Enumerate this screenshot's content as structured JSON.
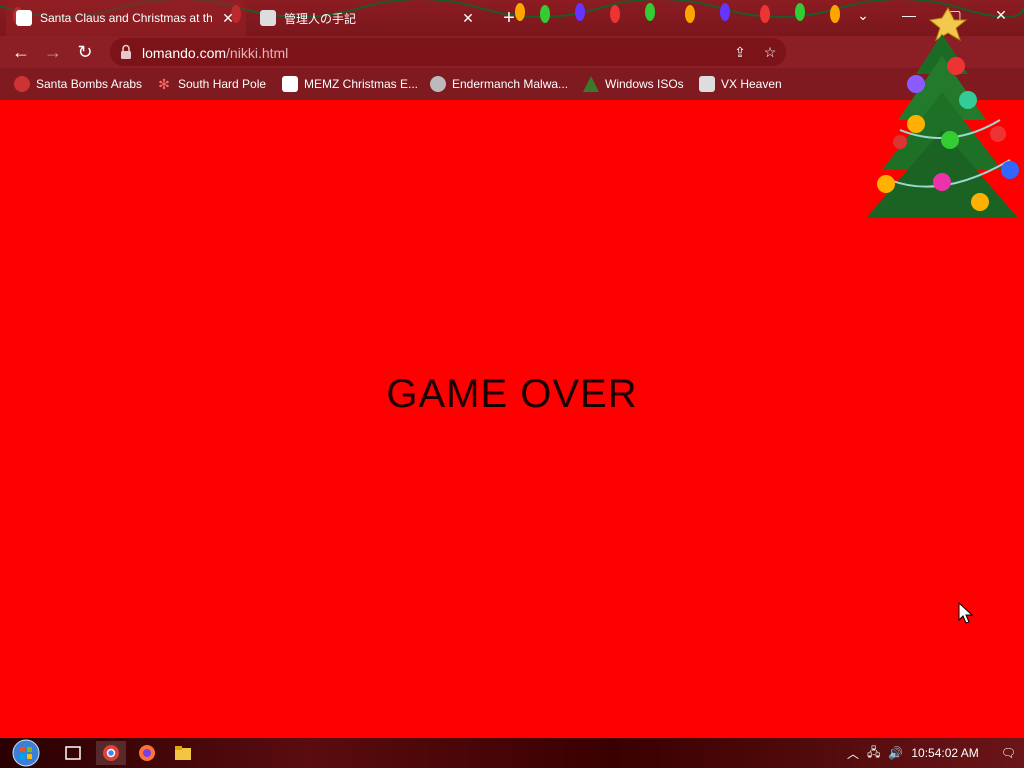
{
  "browser": {
    "tabs": [
      {
        "title": "Santa Claus and Christmas at the",
        "active": true
      },
      {
        "title": "管理人の手記",
        "active": false
      }
    ],
    "url_host": "lomando.com",
    "url_path": "/nikki.html"
  },
  "bookmarks": [
    {
      "label": "Santa Bombs Arabs",
      "icon": "santa-icon"
    },
    {
      "label": "South Hard Pole",
      "icon": "snowflake-icon"
    },
    {
      "label": "MEMZ Christmas E...",
      "icon": "memz-icon"
    },
    {
      "label": "Endermanch Malwa...",
      "icon": "raccoon-icon"
    },
    {
      "label": "Windows ISOs",
      "icon": "tree-icon"
    },
    {
      "label": "VX Heaven",
      "icon": "vx-icon"
    }
  ],
  "page": {
    "message": "GAME OVER",
    "background": "#ff0000"
  },
  "taskbar": {
    "time": "10:54:02 AM"
  },
  "colors": {
    "chrome_frame": "#8b1c22",
    "bookmarks_bar": "#7e1a20"
  }
}
